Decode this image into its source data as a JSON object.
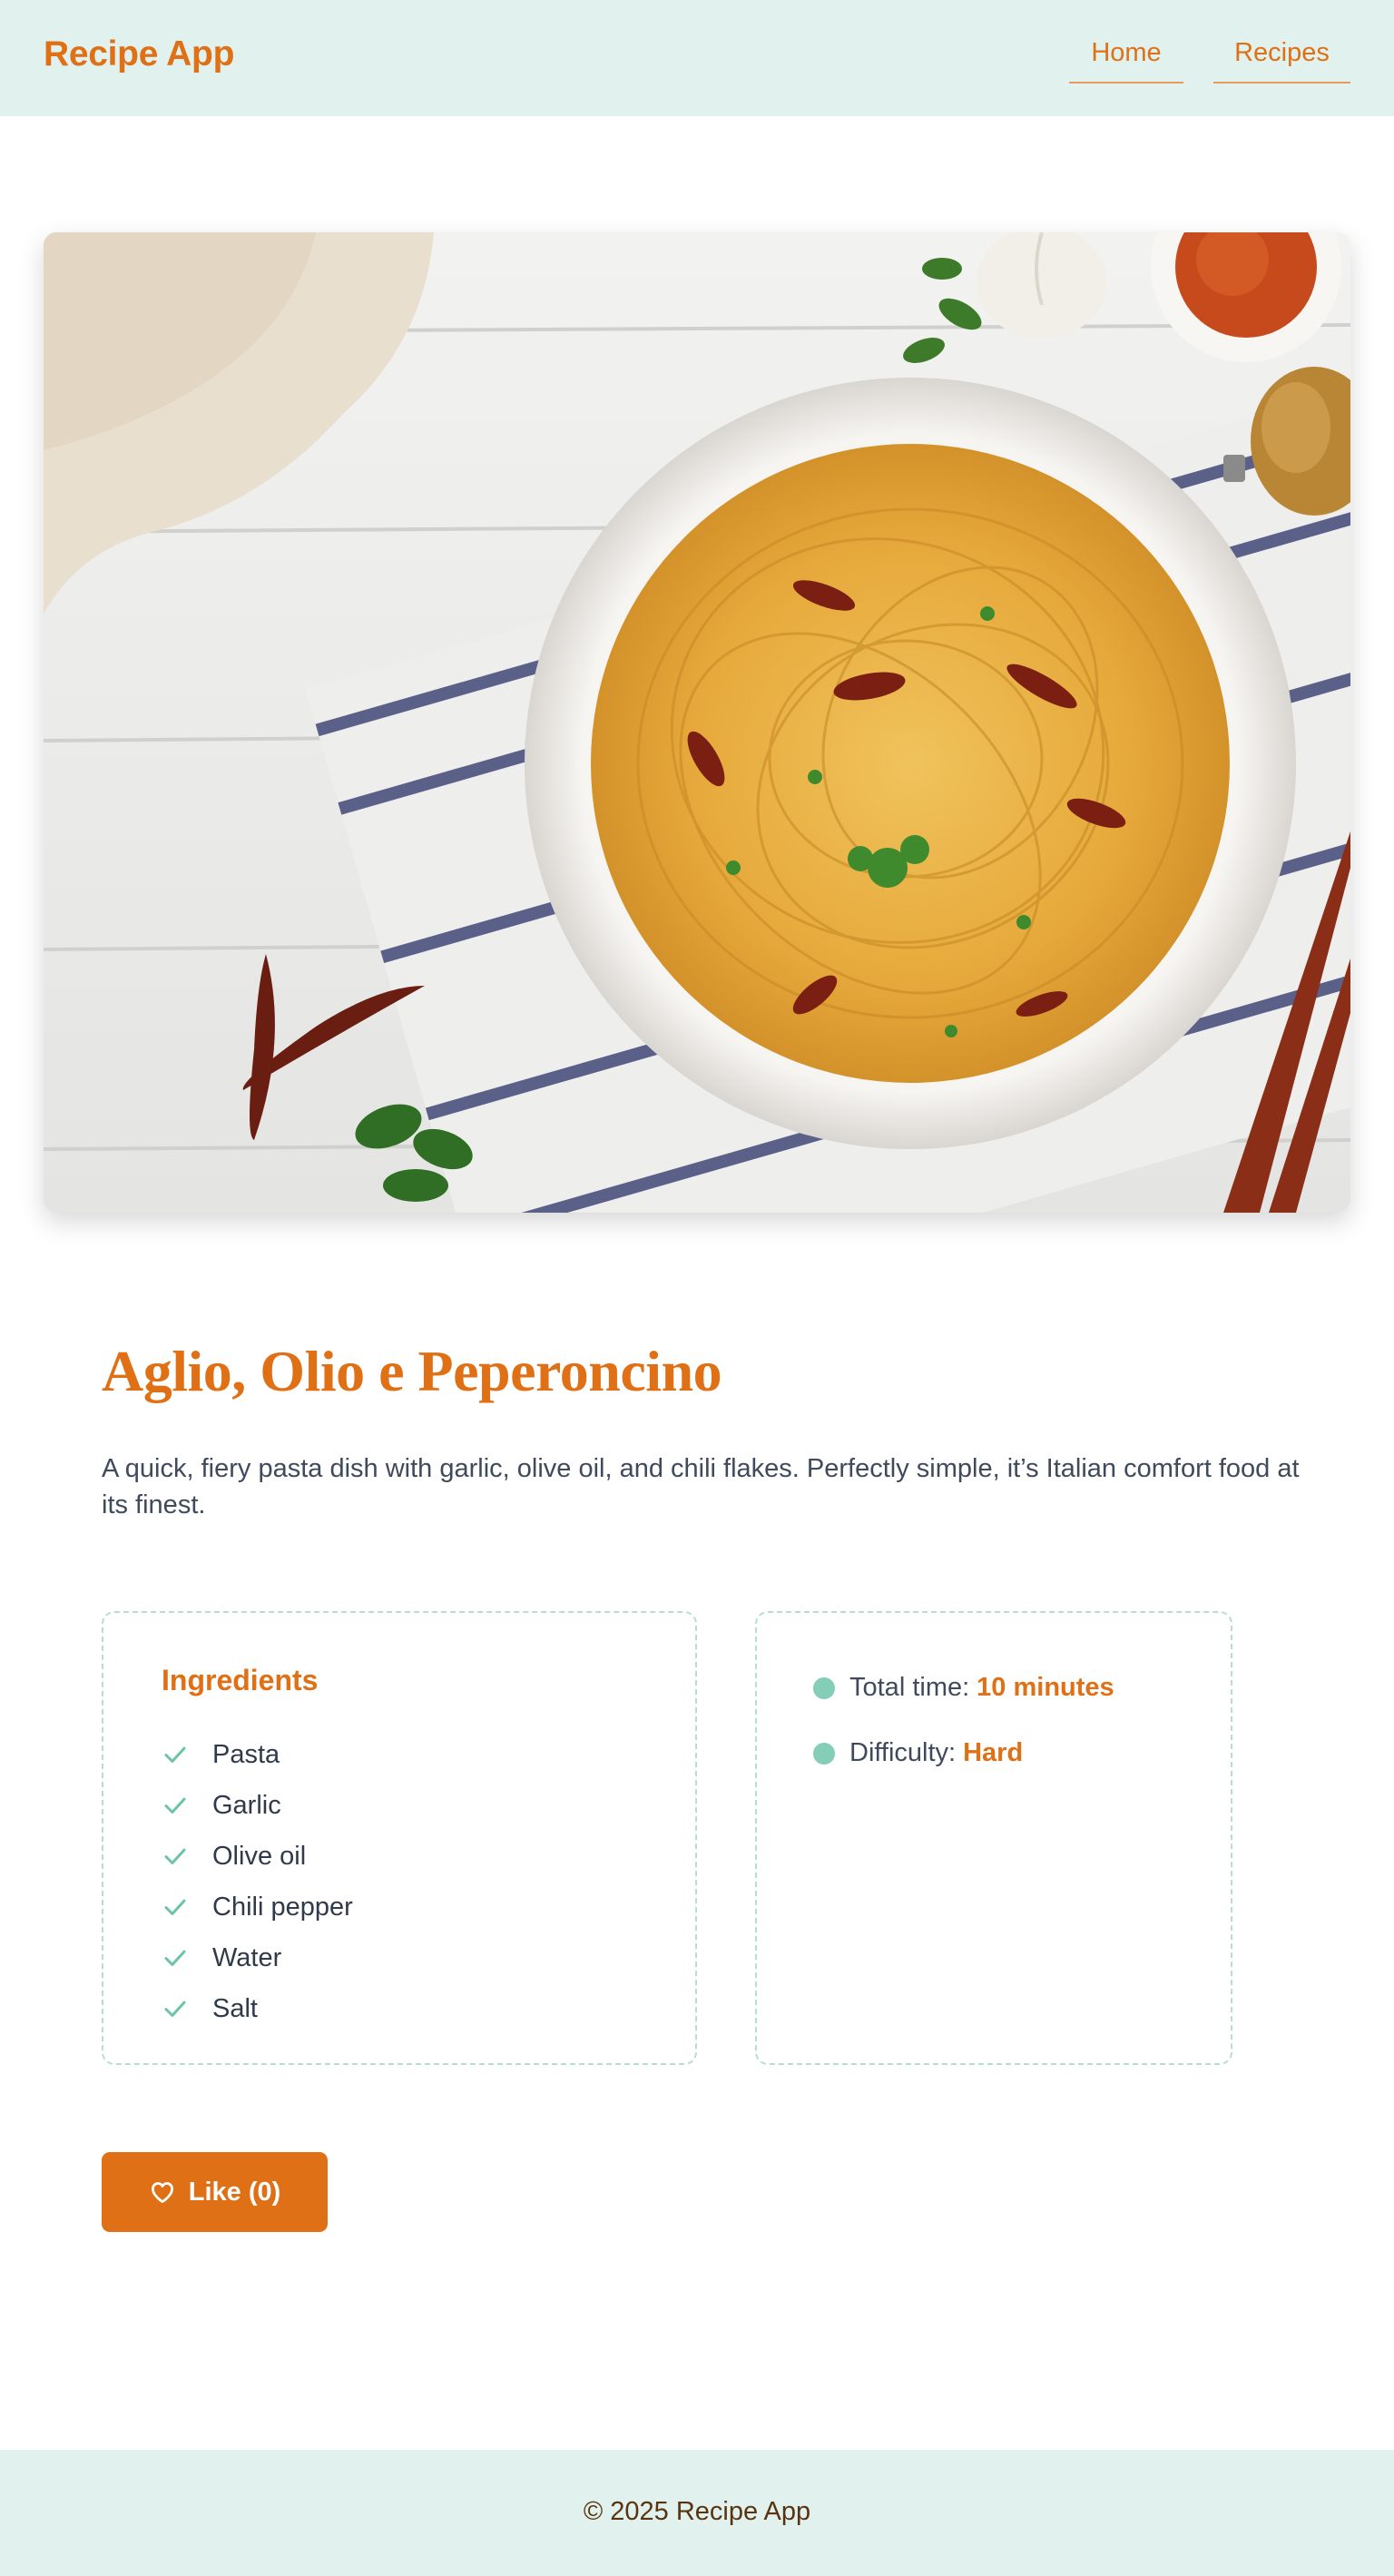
{
  "header": {
    "brand": "Recipe App",
    "nav": [
      {
        "label": "Home"
      },
      {
        "label": "Recipes"
      }
    ]
  },
  "recipe": {
    "title": "Aglio, Olio e Peperoncino",
    "description": "A quick, fiery pasta dish with garlic, olive oil, and chili flakes. Perfectly simple, it’s Italian comfort food at its finest.",
    "ingredients_heading": "Ingredients",
    "ingredients": [
      "Pasta",
      "Garlic",
      "Olive oil",
      "Chili pepper",
      "Water",
      "Salt"
    ],
    "info": {
      "time_label": "Total time:",
      "time_value": "10 minutes",
      "difficulty_label": "Difficulty:",
      "difficulty_value": "Hard"
    },
    "like_label": "Like (0)"
  },
  "footer": {
    "text": "© 2025 Recipe App"
  },
  "colors": {
    "accent": "#e07016",
    "header_bg": "#e1f2ee",
    "bullet": "#84cdb6"
  },
  "icons": {
    "check": "check-icon",
    "heart": "heart-icon",
    "dot": "dot-icon"
  }
}
